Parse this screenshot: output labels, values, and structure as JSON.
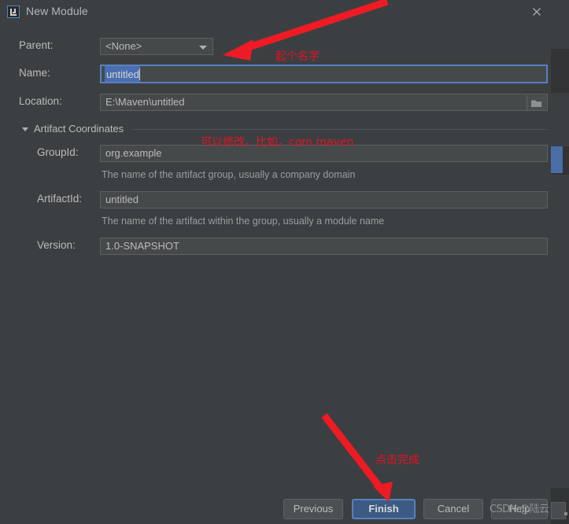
{
  "window": {
    "title": "New Module",
    "app_icon": "intellij-idea-icon",
    "close_icon": "close-icon"
  },
  "form": {
    "parent": {
      "label": "Parent:",
      "value": "<None>",
      "dropdown_icon": "chevron-down-icon"
    },
    "name": {
      "label": "Name:",
      "value": "untitled",
      "selected": true
    },
    "location": {
      "label": "Location:",
      "value": "E:\\Maven\\untitled",
      "browse_icon": "folder-icon"
    }
  },
  "artifact_coordinates": {
    "section_title": "Artifact Coordinates",
    "twisty_icon": "triangle-down-icon",
    "expanded": true,
    "group_id": {
      "label": "GroupId:",
      "value": "org.example",
      "hint": "The name of the artifact group, usually a company domain"
    },
    "artifact_id": {
      "label": "ArtifactId:",
      "value": "untitled",
      "hint": "The name of the artifact within the group, usually a module name"
    },
    "version": {
      "label": "Version:",
      "value": "1.0-SNAPSHOT"
    }
  },
  "buttons": {
    "previous": "Previous",
    "finish": "Finish",
    "cancel": "Cancel",
    "help": "Help"
  },
  "annotations": [
    {
      "id": "name",
      "text": "起个名字"
    },
    {
      "id": "group",
      "text": "可以修改，比如，com.maven"
    },
    {
      "id": "finish",
      "text": "点击完成"
    }
  ],
  "watermark": "CSDN @陆云",
  "colors": {
    "dialog_bg": "#3c3f41",
    "field_bg": "#45494a",
    "field_border": "#5e6060",
    "text": "#bbbbbb",
    "hint_text": "#9a9d9f",
    "focus_border": "#5781c0",
    "selection_bg": "#4b6eaf",
    "primary_button_bg": "#3c5a82",
    "annotation_red": "#e81123"
  }
}
